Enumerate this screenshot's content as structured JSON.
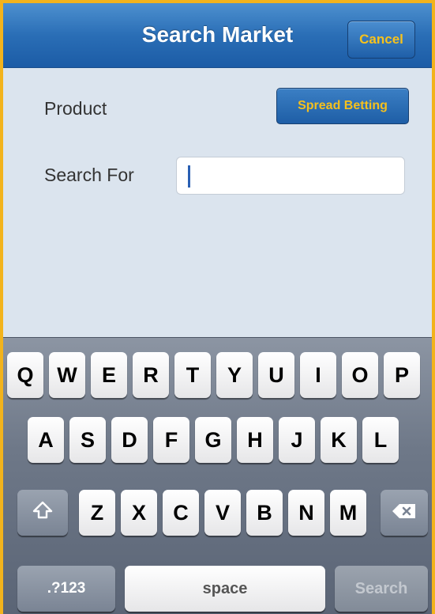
{
  "nav": {
    "title": "Search Market",
    "cancel_label": "Cancel"
  },
  "form": {
    "product_label": "Product",
    "product_value": "Spread Betting",
    "search_label": "Search For",
    "search_value": ""
  },
  "keyboard": {
    "row1": [
      "Q",
      "W",
      "E",
      "R",
      "T",
      "Y",
      "U",
      "I",
      "O",
      "P"
    ],
    "row2": [
      "A",
      "S",
      "D",
      "F",
      "G",
      "H",
      "J",
      "K",
      "L"
    ],
    "row3": [
      "Z",
      "X",
      "C",
      "V",
      "B",
      "N",
      "M"
    ],
    "shift_icon": "shift-arrow-icon",
    "backspace_icon": "backspace-icon",
    "numbers_label": ".?123",
    "space_label": "space",
    "search_label": "Search"
  },
  "colors": {
    "frame_border": "#f2b31c",
    "button_text": "#f5c01d",
    "nav_blue": "#2a6eb6",
    "form_bg": "#dbe4ee"
  }
}
